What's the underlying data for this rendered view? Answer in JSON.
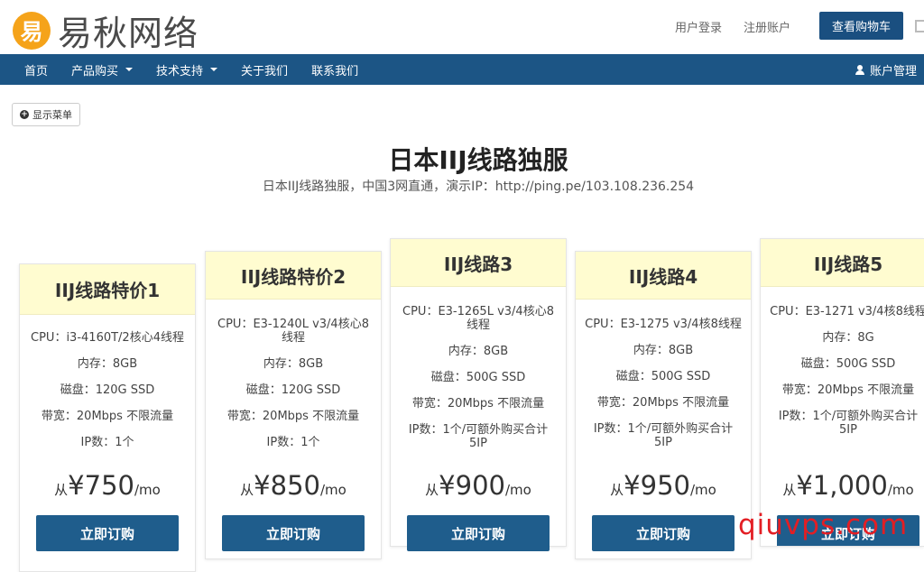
{
  "header": {
    "logo_char": "易",
    "logo_text": "易秋网络",
    "login": "用户登录",
    "register": "注册账户",
    "cart": "查看购物车"
  },
  "nav": {
    "items": [
      "首页",
      "产品购买",
      "技术支持",
      "关于我们",
      "联系我们"
    ],
    "account": "账户管理"
  },
  "menu_toggle": "显示菜单",
  "page": {
    "title": "日本IIJ线路独服",
    "subtitle": "日本IIJ线路独服，中国3网直通，演示IP：http://ping.pe/103.108.236.254"
  },
  "plans": [
    {
      "name": "IIJ线路特价1",
      "cpu": "CPU：i3-4160T/2核心4线程",
      "ram": "内存：8GB",
      "disk": "磁盘：120G SSD",
      "bw": "带宽：20Mbps 不限流量",
      "ip": "IP数：1个",
      "from": "从",
      "price": "¥750",
      "unit": "/mo",
      "button": "立即订购"
    },
    {
      "name": "IIJ线路特价2",
      "cpu": "CPU：E3-1240L v3/4核心8线程",
      "ram": "内存：8GB",
      "disk": "磁盘：120G SSD",
      "bw": "带宽：20Mbps 不限流量",
      "ip": "IP数：1个",
      "from": "从",
      "price": "¥850",
      "unit": "/mo",
      "button": "立即订购"
    },
    {
      "name": "IIJ线路3",
      "cpu": "CPU：E3-1265L v3/4核心8线程",
      "ram": "内存：8GB",
      "disk": "磁盘：500G SSD",
      "bw": "带宽：20Mbps 不限流量",
      "ip": "IP数：1个/可额外购买合计5IP",
      "from": "从",
      "price": "¥900",
      "unit": "/mo",
      "button": "立即订购"
    },
    {
      "name": "IIJ线路4",
      "cpu": "CPU：E3-1275 v3/4核8线程",
      "ram": "内存：8GB",
      "disk": "磁盘：500G SSD",
      "bw": "带宽：20Mbps 不限流量",
      "ip": "IP数：1个/可额外购买合计5IP",
      "from": "从",
      "price": "¥950",
      "unit": "/mo",
      "button": "立即订购"
    },
    {
      "name": "IIJ线路5",
      "cpu": "CPU：E3-1271 v3/4核8线程",
      "ram": "内存：8G",
      "disk": "磁盘：500G SSD",
      "bw": "带宽：20Mbps 不限流量",
      "ip": "IP数：1个/可额外购买合计5IP",
      "from": "从",
      "price": "¥1,000",
      "unit": "/mo",
      "button": "立即订购"
    }
  ],
  "watermark": "qiuvps.com",
  "colors": {
    "nav": "#1c5585",
    "button": "#1f5d8c",
    "card_head": "#fffcd0",
    "logo": "#f5a31a",
    "watermark": "#e31e24"
  }
}
